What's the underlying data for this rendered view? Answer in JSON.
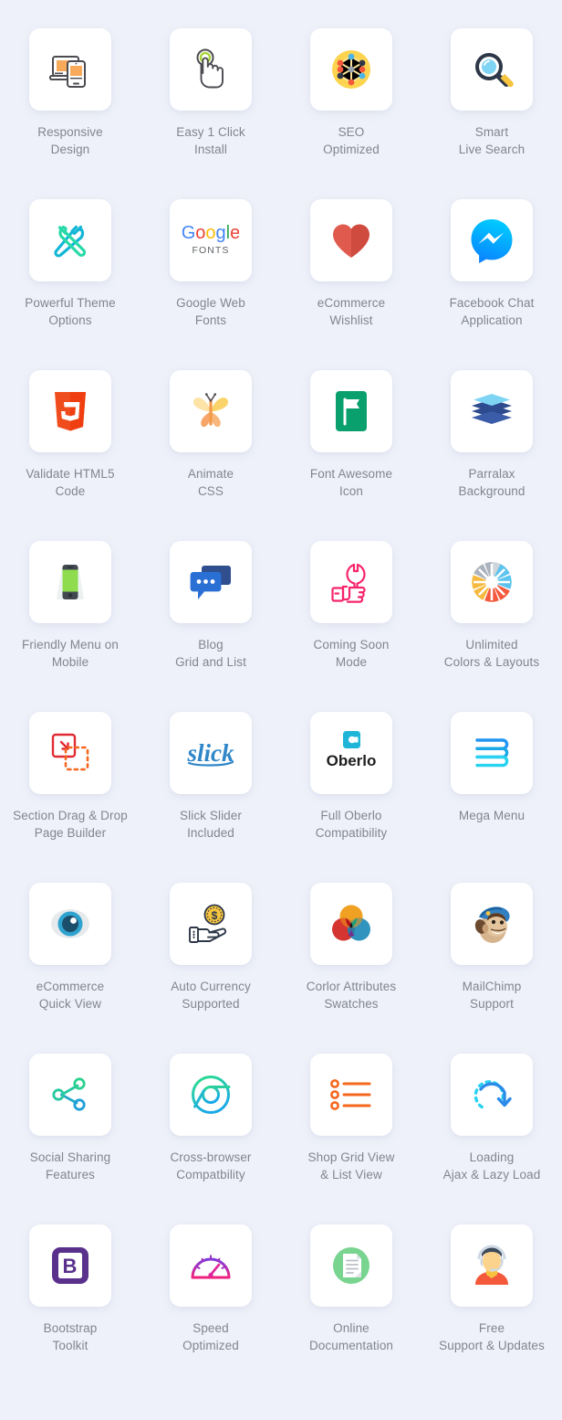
{
  "page": {
    "background_color": "#eef1f9",
    "card_color": "#ffffff",
    "label_color": "#82858f",
    "columns": 4,
    "rows": 8
  },
  "features": [
    {
      "icon": "responsive-devices-icon",
      "label": "Responsive\nDesign"
    },
    {
      "icon": "tap-click-hand-icon",
      "label": "Easy 1 Click\nInstall"
    },
    {
      "icon": "seo-network-nodes-icon",
      "label": "SEO\nOptimized"
    },
    {
      "icon": "magnifier-search-icon",
      "label": "Smart\nLive Search"
    },
    {
      "icon": "screwdriver-wrench-tools-icon",
      "label": "Powerful Theme\nOptions"
    },
    {
      "icon": "google-fonts-logo-icon",
      "label": "Google Web\nFonts"
    },
    {
      "icon": "heart-wishlist-icon",
      "label": "eCommerce\nWishlist"
    },
    {
      "icon": "facebook-messenger-icon",
      "label": "Facebook Chat\nApplication"
    },
    {
      "icon": "html5-shield-icon",
      "label": "Validate HTML5\nCode"
    },
    {
      "icon": "butterfly-animate-icon",
      "label": "Animate\nCSS"
    },
    {
      "icon": "flag-font-awesome-icon",
      "label": "Font Awesome\nIcon"
    },
    {
      "icon": "stacked-layers-icon",
      "label": "Parralax\nBackground"
    },
    {
      "icon": "mobile-phone-menu-icon",
      "label": "Friendly Menu on\nMobile"
    },
    {
      "icon": "chat-bubbles-blog-icon",
      "label": "Blog\nGrid and List"
    },
    {
      "icon": "thumb-up-wrench-icon",
      "label": "Coming Soon\nMode"
    },
    {
      "icon": "color-wheel-icon",
      "label": "Unlimited\nColors & Layouts"
    },
    {
      "icon": "drag-drop-section-icon",
      "label": "Section Drag & Drop\nPage Builder"
    },
    {
      "icon": "slick-slider-logo-icon",
      "label": "Slick Slider\nIncluded"
    },
    {
      "icon": "oberlo-logo-icon",
      "label": "Full Oberlo\nCompatibility"
    },
    {
      "icon": "mega-menu-lines-icon",
      "label": "Mega Menu"
    },
    {
      "icon": "eye-quick-view-icon",
      "label": "eCommerce\nQuick View"
    },
    {
      "icon": "hand-coin-currency-icon",
      "label": "Auto Currency\nSupported"
    },
    {
      "icon": "color-swatch-circles-icon",
      "label": "Corlor Attributes\nSwatches"
    },
    {
      "icon": "mailchimp-monkey-icon",
      "label": "MailChimp\nSupport"
    },
    {
      "icon": "share-nodes-icon",
      "label": "Social Sharing\nFeatures"
    },
    {
      "icon": "chrome-browser-icon",
      "label": "Cross-browser\nCompatbility"
    },
    {
      "icon": "list-grid-view-icon",
      "label": "Shop Grid View\n& List View"
    },
    {
      "icon": "loading-refresh-arrow-icon",
      "label": "Loading\nAjax & Lazy Load"
    },
    {
      "icon": "bootstrap-logo-icon",
      "label": "Bootstrap\nToolkit"
    },
    {
      "icon": "speedometer-gauge-icon",
      "label": "Speed\nOptimized"
    },
    {
      "icon": "document-page-icon",
      "label": "Online\nDocumentation"
    },
    {
      "icon": "support-agent-headset-icon",
      "label": "Free\nSupport & Updates"
    }
  ],
  "icon_colors": {
    "orange": "#f9a95a",
    "dark_gray": "#4b4b51",
    "yellow": "#fcd44f",
    "blue": "#4cb5e8",
    "red": "#f4593c",
    "teal": "#2ac3a2",
    "deep_blue": "#2196f3",
    "pink": "#f6256c",
    "purple": "#6f2f8f",
    "green": "#7ed957",
    "navy": "#2e4b8f"
  }
}
